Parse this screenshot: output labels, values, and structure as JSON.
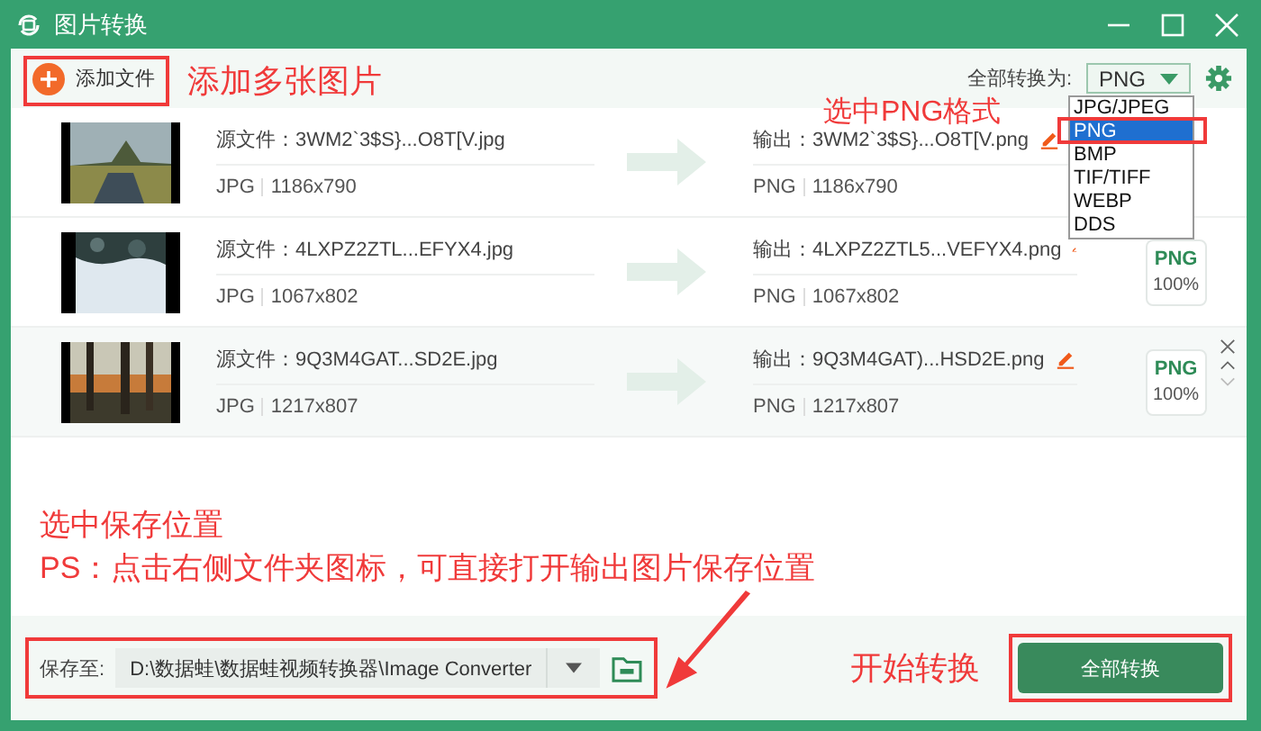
{
  "window": {
    "title": "图片转换"
  },
  "toolbar": {
    "add_button": "添加文件",
    "convert_all_label": "全部转换为:",
    "format_select": "PNG"
  },
  "format_menu": [
    {
      "label": "JPG/JPEG",
      "selected": false
    },
    {
      "label": "PNG",
      "selected": true
    },
    {
      "label": "BMP",
      "selected": false
    },
    {
      "label": "TIF/TIFF",
      "selected": false
    },
    {
      "label": "WEBP",
      "selected": false
    },
    {
      "label": "DDS",
      "selected": false
    }
  ],
  "files": [
    {
      "source": "源文件：3WM2`3$S}...O8T[V.jpg",
      "source_format": "JPG",
      "source_size": "1186x790",
      "output": "输出：3WM2`3$S}...O8T[V.png",
      "output_format": "PNG",
      "output_size": "1186x790",
      "hovered": false
    },
    {
      "source": "源文件：4LXPZ2ZTL...EFYX4.jpg",
      "source_format": "JPG",
      "source_size": "1067x802",
      "output": "输出：4LXPZ2ZTL5...VEFYX4.png",
      "output_format": "PNG",
      "output_size": "1067x802",
      "hovered": false,
      "badge": {
        "format": "PNG",
        "quality": "100%"
      }
    },
    {
      "source": "源文件：9Q3M4GAT...SD2E.jpg",
      "source_format": "JPG",
      "source_size": "1217x807",
      "output": "输出：9Q3M4GAT)...HSD2E.png",
      "output_format": "PNG",
      "output_size": "1217x807",
      "hovered": true,
      "badge": {
        "format": "PNG",
        "quality": "100%"
      }
    }
  ],
  "save": {
    "label": "保存至:",
    "path": "D:\\数据蛙\\数据蛙视频转换器\\Image Converter"
  },
  "start_button": "全部转换",
  "annotations": {
    "add": "添加多张图片",
    "format": "选中PNG格式",
    "save_title": "选中保存位置",
    "save_hint": "PS：点击右侧文件夹图标，可直接打开输出图片保存位置",
    "start": "开始转换"
  }
}
